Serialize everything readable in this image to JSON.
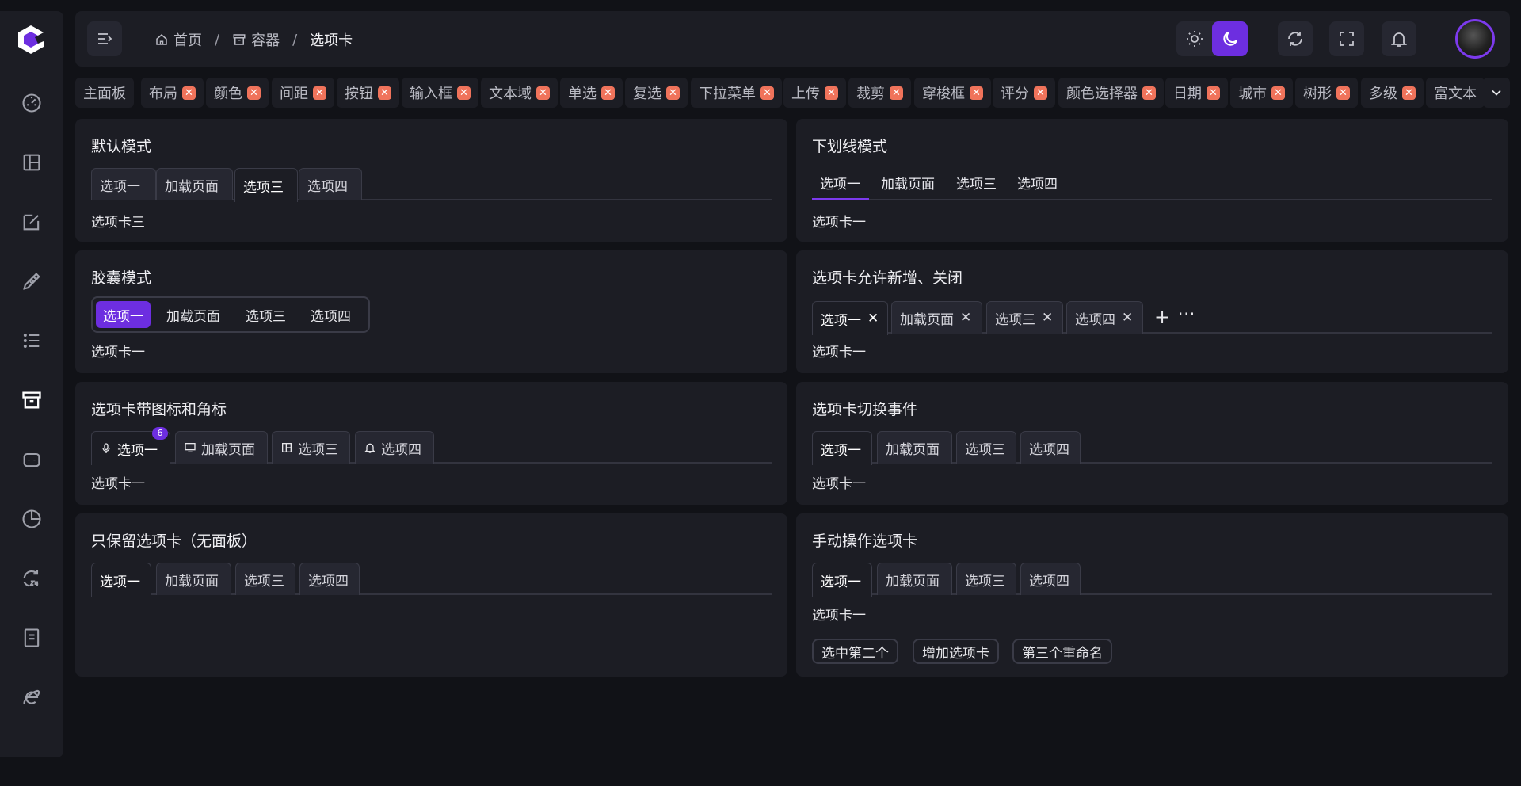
{
  "colors": {
    "accent": "#6d2ee0",
    "bg": "#111217",
    "card": "#1c1d24",
    "tag_close": "#f0735b"
  },
  "sidebar": {
    "items": [
      {
        "icon": "dashboard-icon"
      },
      {
        "icon": "layout-icon"
      },
      {
        "icon": "edit-icon"
      },
      {
        "icon": "pen-tool-icon"
      },
      {
        "icon": "list-icon"
      },
      {
        "icon": "archive-icon"
      },
      {
        "icon": "robot-icon"
      },
      {
        "icon": "pie-chart-icon"
      },
      {
        "icon": "history-24-icon"
      },
      {
        "icon": "document-icon"
      },
      {
        "icon": "ie-browser-icon"
      }
    ]
  },
  "breadcrumb": {
    "home": "首页",
    "containers": "容器",
    "current": "选项卡"
  },
  "tags": [
    {
      "label": "主面板",
      "closable": false
    },
    {
      "label": "布局",
      "closable": true
    },
    {
      "label": "颜色",
      "closable": true
    },
    {
      "label": "间距",
      "closable": true
    },
    {
      "label": "按钮",
      "closable": true
    },
    {
      "label": "输入框",
      "closable": true
    },
    {
      "label": "文本域",
      "closable": true
    },
    {
      "label": "单选",
      "closable": true
    },
    {
      "label": "复选",
      "closable": true
    },
    {
      "label": "下拉菜单",
      "closable": true
    },
    {
      "label": "上传",
      "closable": true
    },
    {
      "label": "裁剪",
      "closable": true
    },
    {
      "label": "穿梭框",
      "closable": true
    },
    {
      "label": "评分",
      "closable": true
    },
    {
      "label": "颜色选择器",
      "closable": true
    },
    {
      "label": "日期",
      "closable": true
    },
    {
      "label": "城市",
      "closable": true
    },
    {
      "label": "树形",
      "closable": true
    },
    {
      "label": "多级",
      "closable": true
    },
    {
      "label": "富文本",
      "closable": false
    }
  ],
  "tag_close_glyph": "✕",
  "cards": {
    "default": {
      "title": "默认模式",
      "tabs": [
        "选项一",
        "加载页面",
        "选项三",
        "选项四"
      ],
      "active": 2,
      "content": "选项卡三"
    },
    "underline": {
      "title": "下划线模式",
      "tabs": [
        "选项一",
        "加载页面",
        "选项三",
        "选项四"
      ],
      "active": 0,
      "content": "选项卡一"
    },
    "capsule": {
      "title": "胶囊模式",
      "tabs": [
        "选项一",
        "加载页面",
        "选项三",
        "选项四"
      ],
      "active": 0,
      "content": "选项卡一"
    },
    "closable": {
      "title": "选项卡允许新增、关闭",
      "tabs": [
        "选项一",
        "加载页面",
        "选项三",
        "选项四"
      ],
      "active": 0,
      "content": "选项卡一",
      "add": "+",
      "more": "···",
      "close": "✕"
    },
    "icons": {
      "title": "选项卡带图标和角标",
      "tabs": [
        "选项一",
        "加载页面",
        "选项三",
        "选项四"
      ],
      "badge": "6",
      "active": 0,
      "content": "选项卡一",
      "icons": [
        "microphone-icon",
        "monitor-icon",
        "layout-icon",
        "bell-icon"
      ]
    },
    "event": {
      "title": "选项卡切换事件",
      "tabs": [
        "选项一",
        "加载页面",
        "选项三",
        "选项四"
      ],
      "active": 0,
      "content": "选项卡一"
    },
    "nopanel": {
      "title": "只保留选项卡（无面板）",
      "tabs": [
        "选项一",
        "加载页面",
        "选项三",
        "选项四"
      ],
      "active": 0
    },
    "manual": {
      "title": "手动操作选项卡",
      "tabs": [
        "选项一",
        "加载页面",
        "选项三",
        "选项四"
      ],
      "active": 0,
      "content": "选项卡一",
      "buttons": [
        "选中第二个",
        "增加选项卡",
        "第三个重命名"
      ]
    }
  }
}
